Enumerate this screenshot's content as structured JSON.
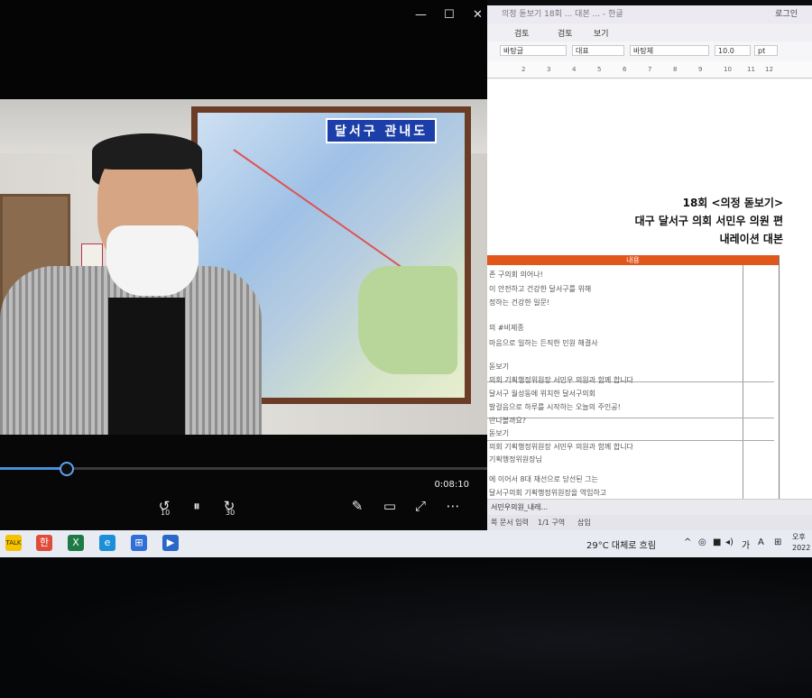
{
  "player": {
    "window_buttons": [
      "—",
      "☐",
      "✕"
    ],
    "map_title": "달서구 관내도",
    "progress": 0.135,
    "time": "0:08:10",
    "controls": {
      "back": "↺",
      "back_label": "10",
      "pause": "⏸",
      "forward": "↻",
      "forward_label": "30",
      "edit": "✎",
      "miniplayer": "▭",
      "fullscreen": "⤢",
      "more": "⋯"
    }
  },
  "doc": {
    "title": "의정 돋보기 18회 ... 대본 ... - 한글",
    "user": "로그인",
    "menu": [
      "검토",
      "검토",
      "보기"
    ],
    "font_style": "바탕글",
    "font_kind": "대표",
    "font_name": "바탕체",
    "font_size": "10.0",
    "font_unit": "pt",
    "ruler": [
      "2",
      "3",
      "4",
      "5",
      "6",
      "7",
      "8",
      "9",
      "10",
      "11",
      "12"
    ],
    "headings": [
      "18회 <의정 돋보기>",
      "대구 달서구 의회 서민우 의원 편",
      "내레이션 대본"
    ],
    "table_header": "내용",
    "table_lines": [
      "존 구의회 의어나!",
      "이 안전하고 건강한 달서구를 위해",
      "정하는 건강한 일문!",
      "의 #비제종",
      "마음으로 일하는 든직한 민원 해결사",
      "돋보기",
      "의회 기획행정위원장 서민우 의원과 함께 합니다",
      "달서구 월성동에 위치한 달서구의회",
      "발걸음으로 하루를 시작하는 오늘의 주인공!",
      "만나볼까요?",
      "돋보기",
      "의회 기획행정위원장 서민우 의원과 함께 합니다",
      "기획행정위원장님",
      "에 이어서 8대 재선으로 당선된 그는",
      "달서구의회 기획행정위원장을 역임하고"
    ],
    "tab": "서민우의원_내레...",
    "status_page": "1/1 구역",
    "status_insert": "삽입",
    "status_left": "쪽 문서 입력"
  },
  "taskbar": {
    "apps": [
      {
        "name": "kakaotalk",
        "label": "TALK",
        "color": "#f5c200"
      },
      {
        "name": "hwp",
        "label": "한",
        "color": "#e14b3b"
      },
      {
        "name": "excel",
        "label": "X",
        "color": "#1f7a45"
      },
      {
        "name": "edge",
        "label": "e",
        "color": "#1b8fd8"
      },
      {
        "name": "app",
        "label": "⊞",
        "color": "#2f6fd6"
      },
      {
        "name": "media-player",
        "label": "▶",
        "color": "#2a67c9"
      }
    ],
    "weather": "29°C 대체로 흐림",
    "tray_glyphs": [
      "^",
      "◎",
      "■",
      "◂)",
      "A",
      "⊞"
    ],
    "ime": "가",
    "ime2": "A",
    "clock_top": "오후",
    "clock_bottom": "2022"
  }
}
